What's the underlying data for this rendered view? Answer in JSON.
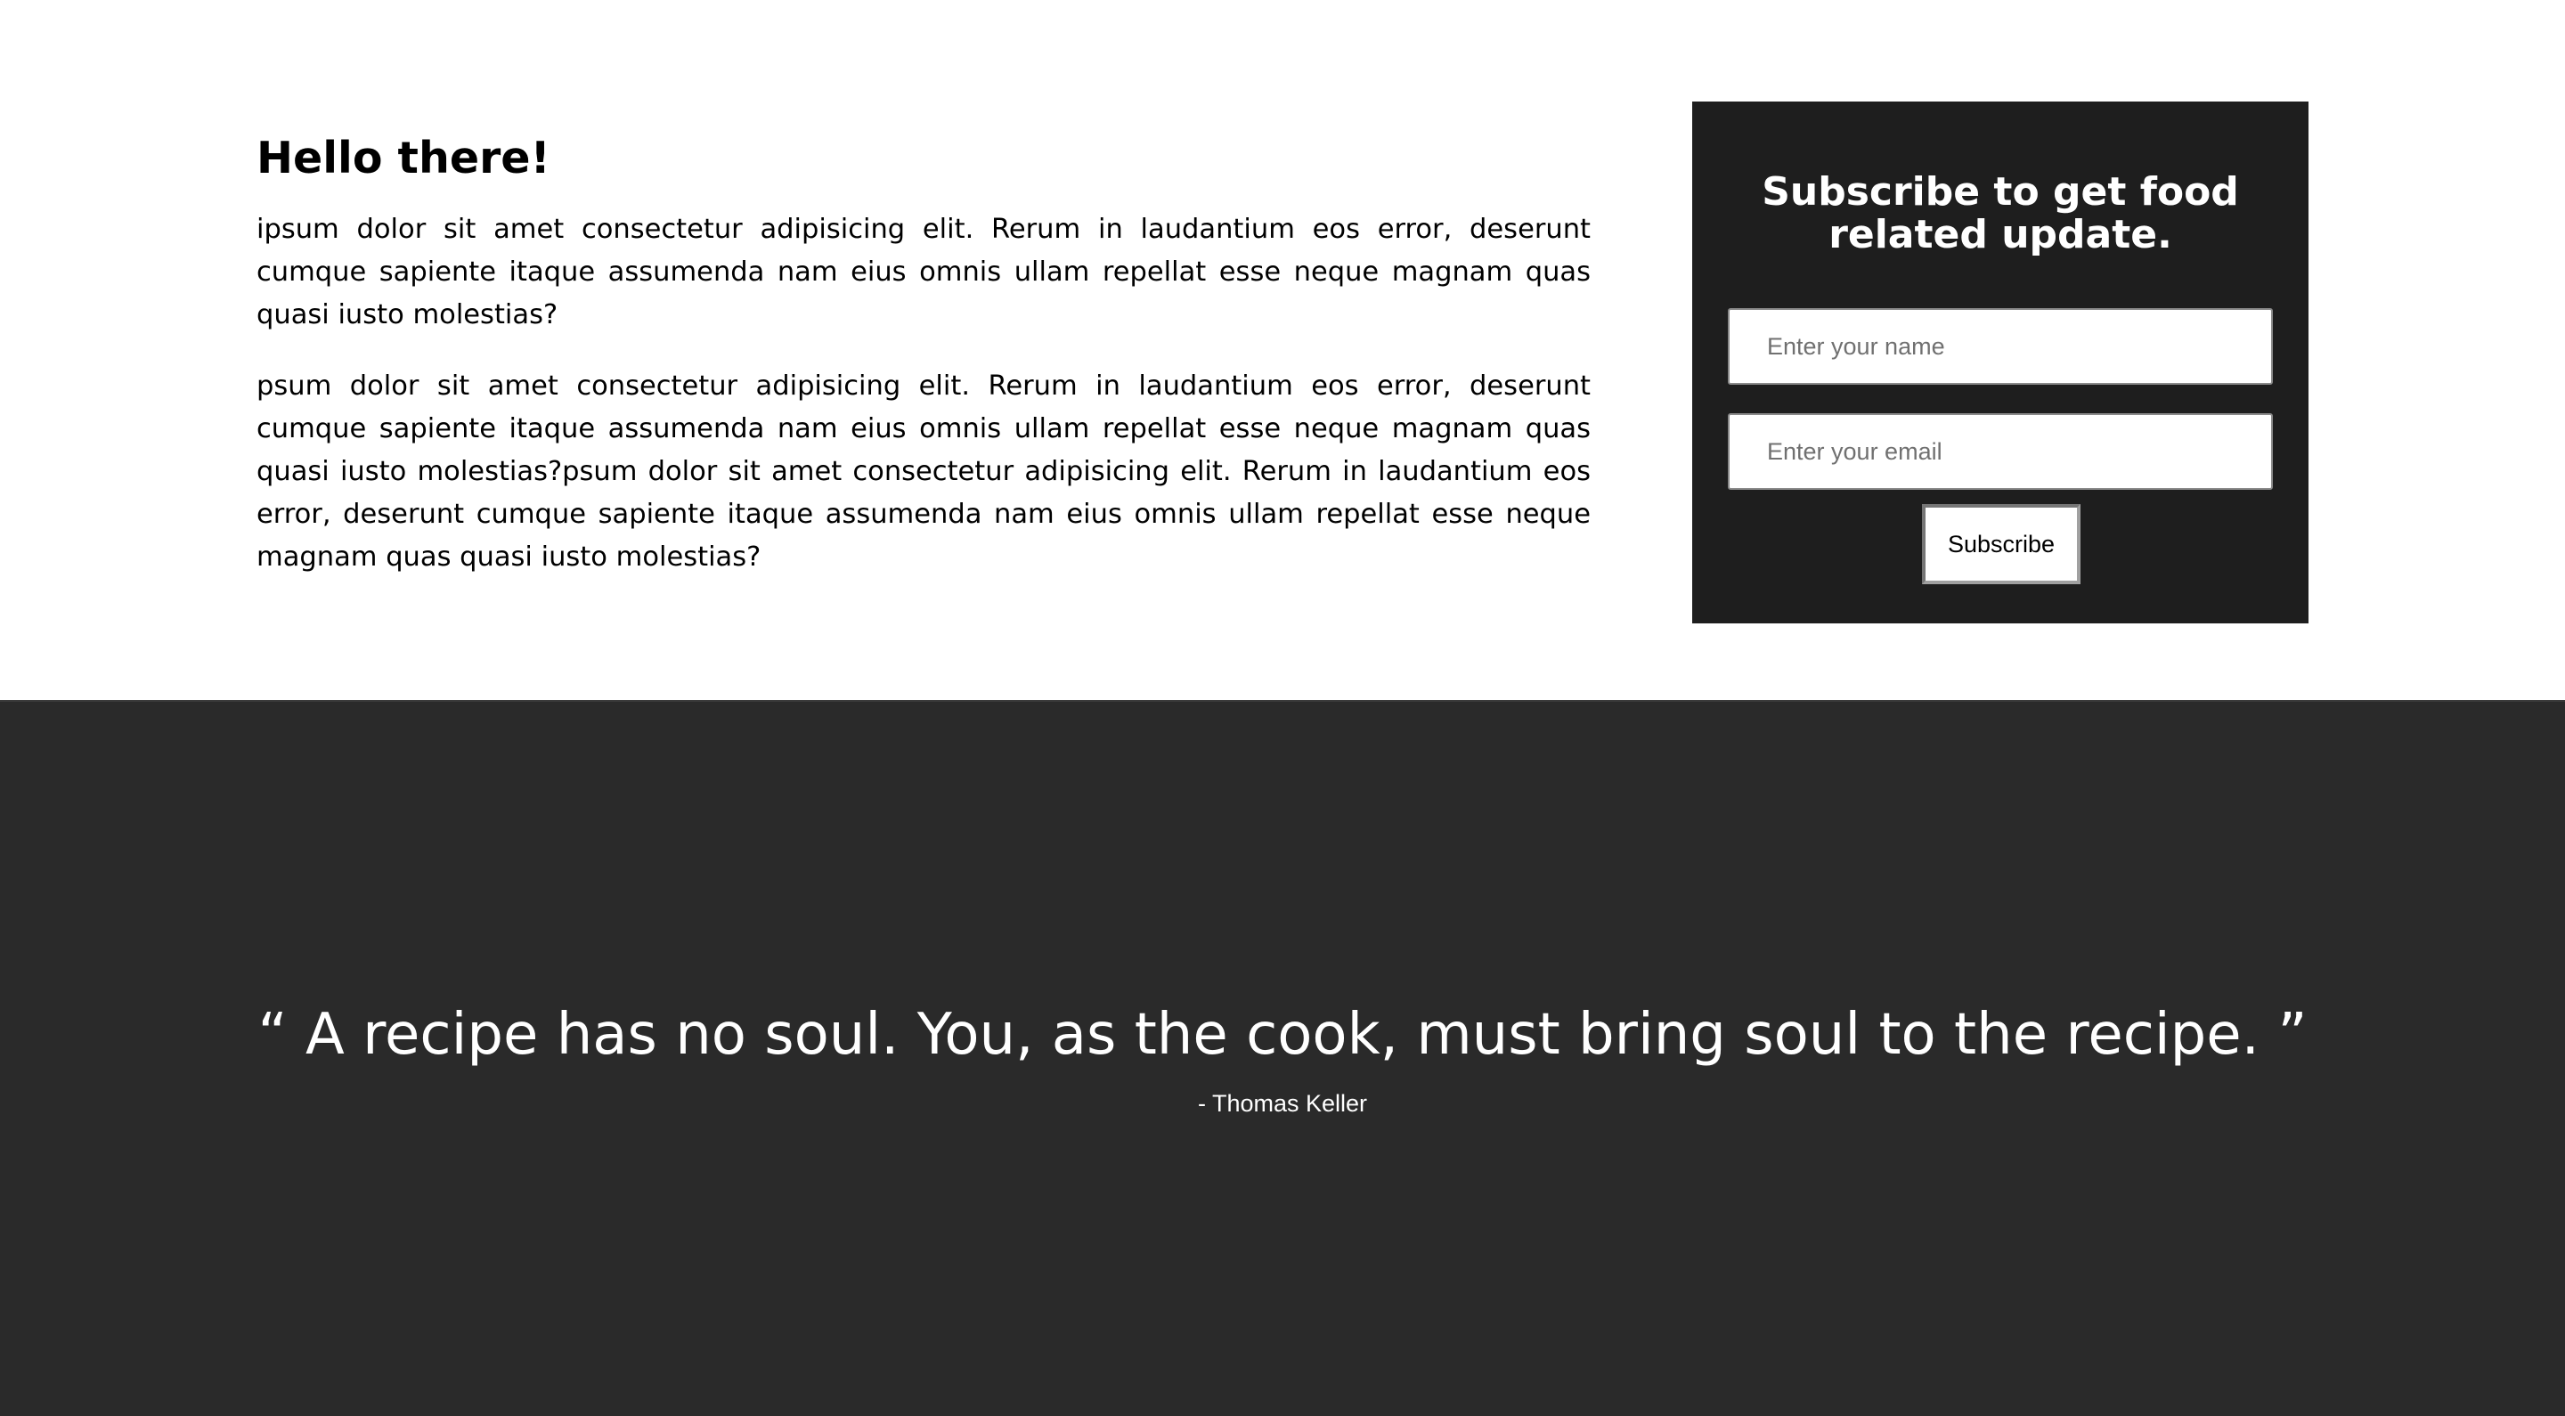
{
  "intro": {
    "heading": "Hello there!",
    "paragraphs": [
      "ipsum dolor sit amet consectetur adipisicing elit. Rerum in laudantium eos error, deserunt cumque sapiente itaque assumenda nam eius omnis ullam repellat esse neque magnam quas quasi iusto molestias?",
      "psum dolor sit amet consectetur adipisicing elit. Rerum in laudantium eos error, deserunt cumque sapiente itaque assumenda nam eius omnis ullam repellat esse neque magnam quas quasi iusto molestias?psum dolor sit amet consectetur adipisicing elit. Rerum in laudantium eos error, deserunt cumque sapiente itaque assumenda nam eius omnis ullam repellat esse neque magnam quas quasi iusto molestias?"
    ]
  },
  "subscribe": {
    "title": "Subscribe to get food related update.",
    "name_value": "",
    "name_placeholder": "Enter your name",
    "email_value": "",
    "email_placeholder": "Enter your email",
    "button_label": "Subscribe"
  },
  "quote": {
    "text": "“ A recipe has no soul. You, as the cook, must bring soul to the recipe. ”",
    "author": "- Thomas Keller"
  },
  "colors": {
    "page_background": "#ffffff",
    "card_background": "#1e1e1e",
    "quote_background": "#2a2a2a",
    "light_text": "#ffffff",
    "dark_text": "#000000"
  }
}
